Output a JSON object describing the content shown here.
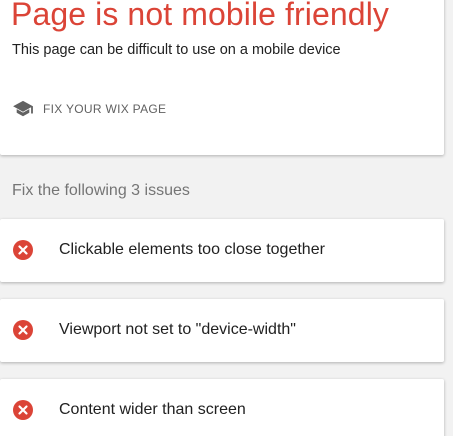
{
  "colors": {
    "headline": "#db4437",
    "error_icon": "#db4437",
    "text": "#212121",
    "muted": "#757575",
    "background": "#f2f2f2"
  },
  "summary": {
    "title": "Page is not mobile friendly",
    "subtitle": "This page can be difficult to use on a mobile device",
    "fix_link": {
      "icon": "graduation-cap-icon",
      "label": "FIX YOUR WIX PAGE"
    }
  },
  "issues": {
    "heading": "Fix the following 3 issues",
    "items": [
      {
        "icon": "error-circle-icon",
        "label": "Clickable elements too close together"
      },
      {
        "icon": "error-circle-icon",
        "label": "Viewport not set to \"device-width\""
      },
      {
        "icon": "error-circle-icon",
        "label": "Content wider than screen"
      }
    ]
  }
}
